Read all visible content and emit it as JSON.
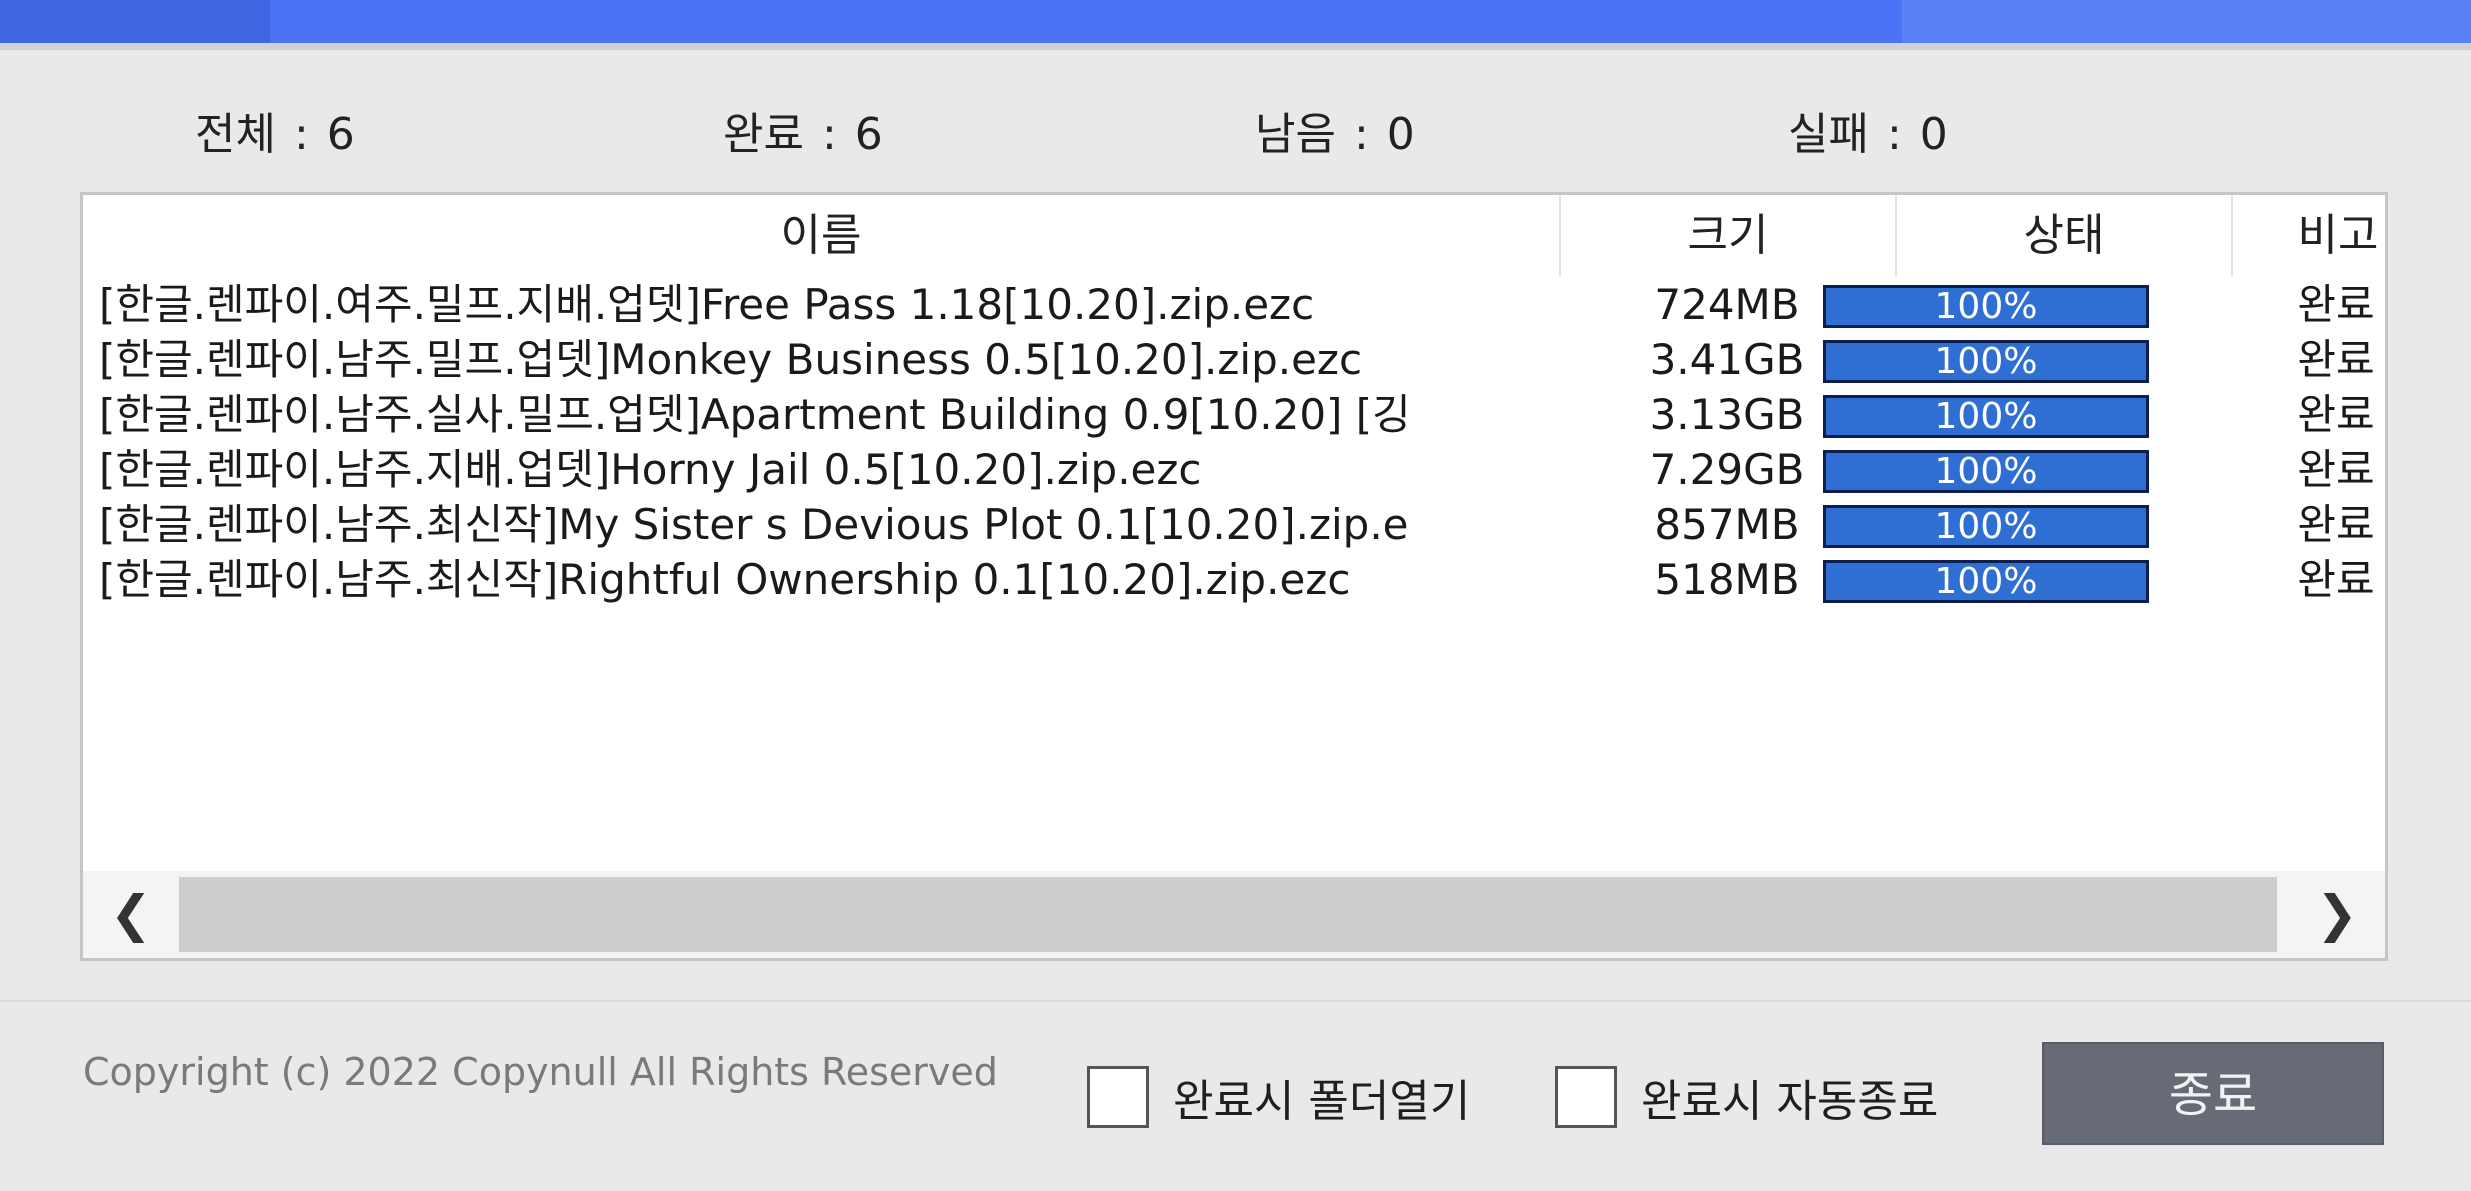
{
  "summary": {
    "total_label": "전체",
    "total_value": "6",
    "done_label": "완료",
    "done_value": "6",
    "remaining_label": "남음",
    "remaining_value": "0",
    "failed_label": "실패",
    "failed_value": "0"
  },
  "table": {
    "columns": [
      "이름",
      "크기",
      "상태",
      "비고"
    ],
    "rows": [
      {
        "name": "[한글.렌파이.여주.밀프.지배.업뎃]Free Pass 1.18[10.20].zip.ezc",
        "size": "724MB",
        "progress": "100%",
        "progress_value": 100,
        "note": "완료"
      },
      {
        "name": "[한글.렌파이.남주.밀프.업뎃]Monkey Business 0.5[10.20].zip.ezc",
        "size": "3.41GB",
        "progress": "100%",
        "progress_value": 100,
        "note": "완료"
      },
      {
        "name": "[한글.렌파이.남주.실사.밀프.업뎃]Apartment Building 0.9[10.20] [깅",
        "size": "3.13GB",
        "progress": "100%",
        "progress_value": 100,
        "note": "완료"
      },
      {
        "name": "[한글.렌파이.남주.지배.업뎃]Horny Jail 0.5[10.20].zip.ezc",
        "size": "7.29GB",
        "progress": "100%",
        "progress_value": 100,
        "note": "완료"
      },
      {
        "name": "[한글.렌파이.남주.최신작]My Sister s Devious Plot 0.1[10.20].zip.e",
        "size": "857MB",
        "progress": "100%",
        "progress_value": 100,
        "note": "완료"
      },
      {
        "name": "[한글.렌파이.남주.최신작]Rightful Ownership 0.1[10.20].zip.ezc",
        "size": "518MB",
        "progress": "100%",
        "progress_value": 100,
        "note": "완료"
      }
    ]
  },
  "scrollbar": {
    "left_icon": "chevron-left-icon",
    "right_icon": "chevron-right-icon",
    "left_glyph": "❮",
    "right_glyph": "❯"
  },
  "footer": {
    "copyright": "Copyright (c) 2022 Copynull All Rights Reserved",
    "open_folder_label": "완료시 폴더열기",
    "auto_exit_label": "완료시 자동종료",
    "close_label": "종료"
  },
  "colors": {
    "title_bar": "#4a74f5",
    "progress": "#2f6fd3",
    "button": "#676b75"
  }
}
